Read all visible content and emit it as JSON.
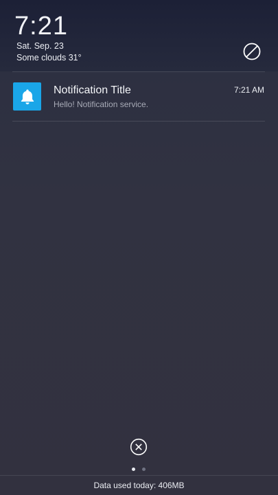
{
  "lockscreen": {
    "time": "7:21",
    "date": "Sat. Sep. 23",
    "weather": "Some clouds 31°"
  },
  "quick_actions": {
    "dnd_icon": "do-not-disturb-icon"
  },
  "notification": {
    "app_icon": "bell-icon",
    "app_icon_color": "#1aa6e8",
    "title": "Notification Title",
    "body": "Hello! Notification service.",
    "time": "7:21 AM"
  },
  "footer": {
    "clear_icon": "close-circle-icon",
    "page_count": 2,
    "active_page": 1,
    "data_usage": "Data used today:  406MB"
  }
}
